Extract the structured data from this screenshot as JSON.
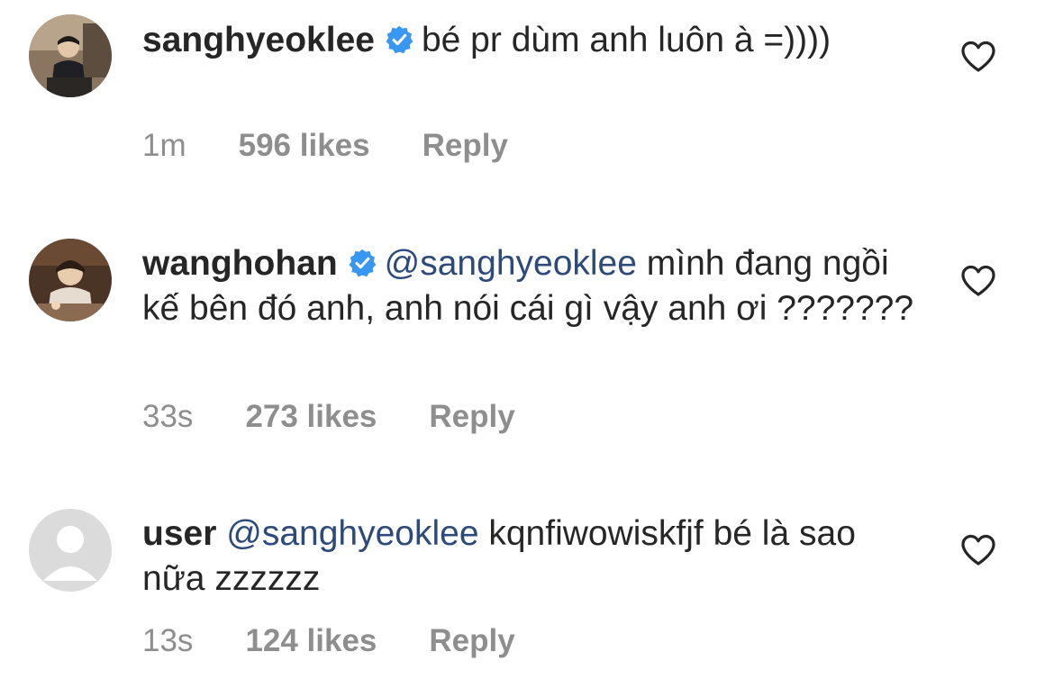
{
  "comments": [
    {
      "username": "sanghyeoklee",
      "verified": true,
      "mention": "",
      "text": "bé pr dùm anh luôn à =))))",
      "time": "1m",
      "likes": "596 likes",
      "reply": "Reply",
      "avatar": "photo-person-dark"
    },
    {
      "username": "wanghohan",
      "verified": true,
      "mention": "@sanghyeoklee",
      "text": "mình đang ngồi kế bên đó anh, anh nói cái gì vậy anh ơi ???????",
      "time": "33s",
      "likes": "273 likes",
      "reply": "Reply",
      "avatar": "photo-person-brown"
    },
    {
      "username": "user",
      "verified": false,
      "mention": "@sanghyeoklee",
      "text": "kqnfiwowiskfjf bé là sao nữa zzzzzz",
      "time": "13s",
      "likes": "124 likes",
      "reply": "Reply",
      "avatar": "default-avatar"
    }
  ],
  "icons": {
    "verified": "verified-badge-icon",
    "like": "heart-outline-icon"
  },
  "colors": {
    "text": "#262626",
    "meta": "#8e8e8e",
    "mention": "#2d4a7a",
    "verified": "#3897f0"
  }
}
